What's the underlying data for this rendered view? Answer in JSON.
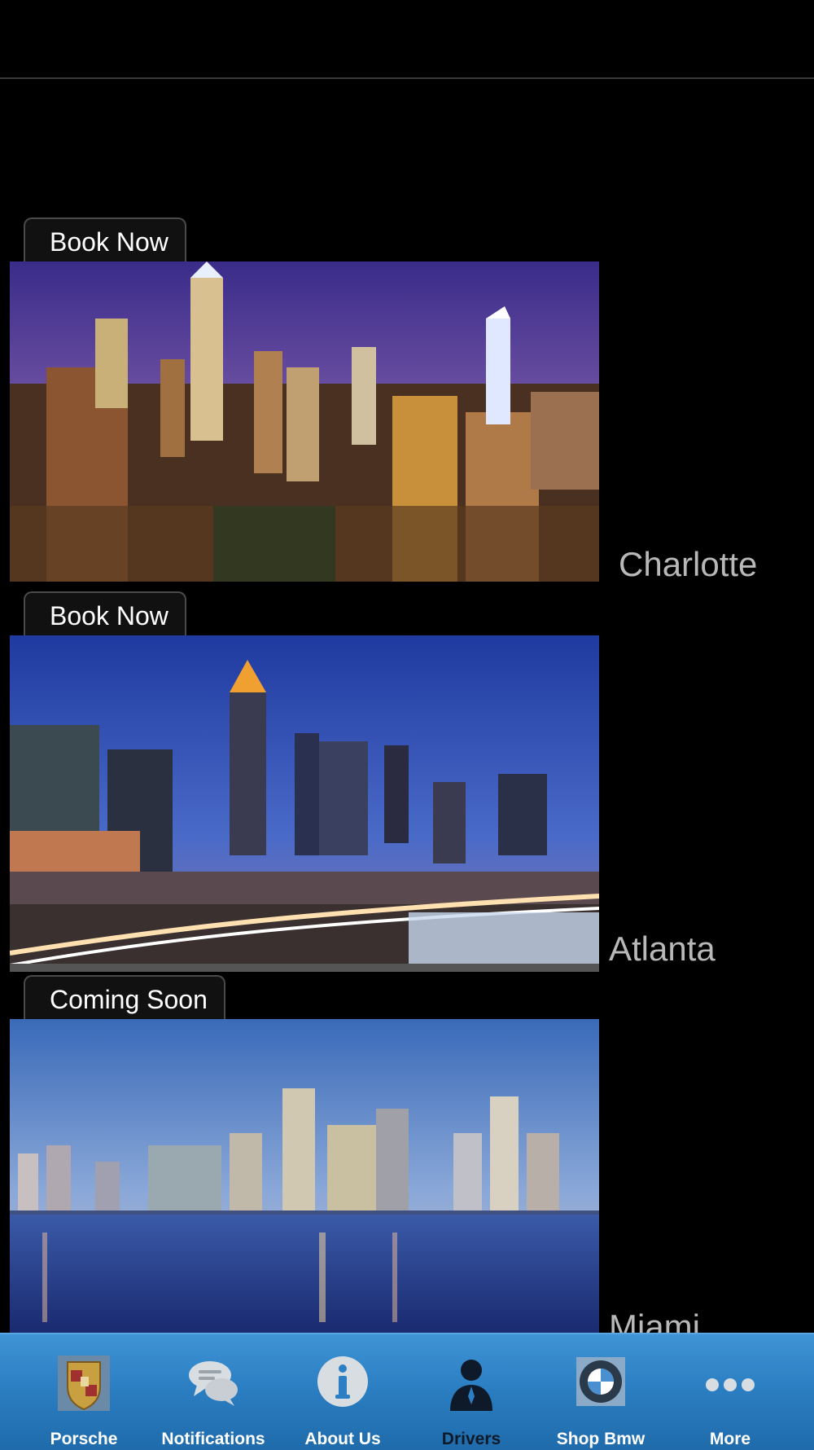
{
  "cities": [
    {
      "name": "Charlotte",
      "button": "Book Now"
    },
    {
      "name": "Atlanta",
      "button": "Book Now"
    },
    {
      "name": "Miami",
      "button": "Coming Soon"
    }
  ],
  "tabbar": {
    "active": "Drivers",
    "items": [
      {
        "label": "Porsche",
        "icon": "porsche-crest-icon"
      },
      {
        "label": "Notifications",
        "icon": "chat-bubbles-icon"
      },
      {
        "label": "About Us",
        "icon": "info-icon"
      },
      {
        "label": "Drivers",
        "icon": "person-icon"
      },
      {
        "label": "Shop Bmw",
        "icon": "bmw-logo-icon"
      },
      {
        "label": "More",
        "icon": "more-dots-icon"
      }
    ]
  },
  "colors": {
    "tabbar": "#2b7fc2",
    "label": "#b8b8b8",
    "background": "#000000"
  }
}
